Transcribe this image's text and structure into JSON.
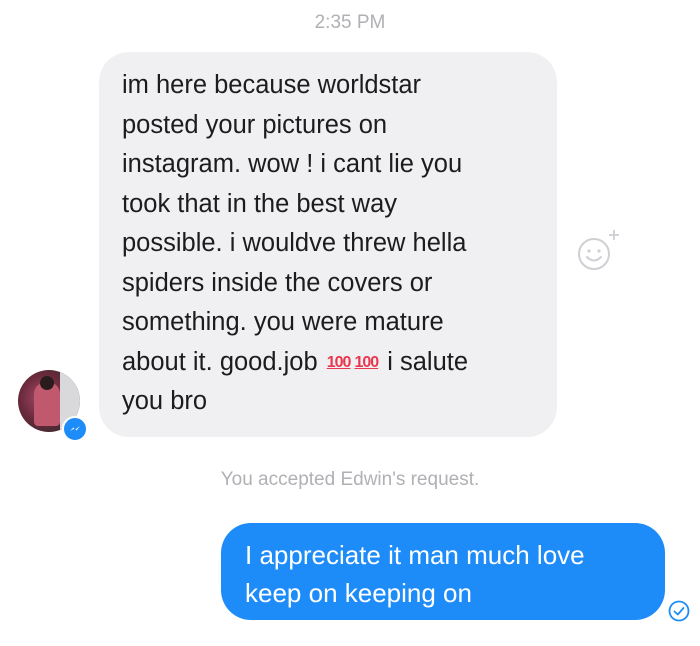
{
  "conversation": {
    "timestamp": "2:35 PM",
    "incoming_message": {
      "lines": [
        "im here because worldstar",
        "posted your pictures on",
        "instagram. wow ! i cant lie you",
        "took that in the best way",
        "possible. i wouldve threw hella",
        "spiders inside the covers or",
        "something. you were mature"
      ],
      "last_line_before": "about it. good.job ",
      "emoji_1": "100",
      "emoji_2": "100",
      "last_line_after": " i salute",
      "final_line": "you bro"
    },
    "system_notice": "You accepted Edwin's request.",
    "outgoing_message": {
      "lines": [
        "I appreciate it man much love",
        "keep on keeping on"
      ]
    }
  },
  "icons": {
    "react": "smiley-add-reaction-icon",
    "badge": "messenger-bolt-icon",
    "status": "delivered-check-icon"
  },
  "colors": {
    "incoming_bubble": "#f0f0f2",
    "outgoing_bubble": "#1d8cf8",
    "meta_text": "#b0b0b5",
    "emoji_100": "#e8384f"
  }
}
